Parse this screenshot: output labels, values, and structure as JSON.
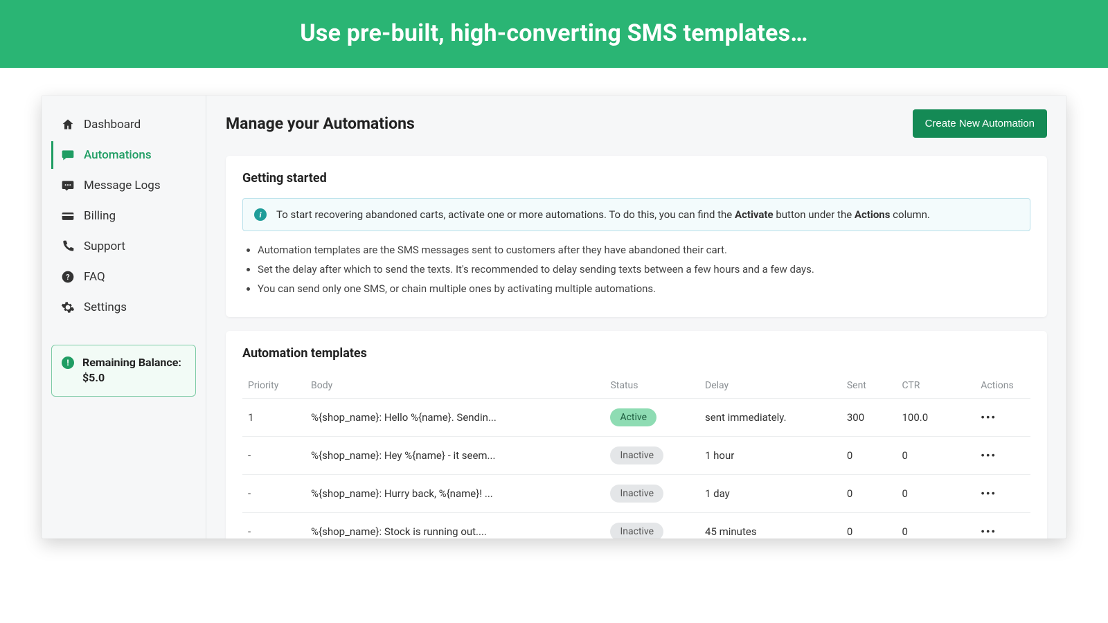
{
  "banner": {
    "headline": "Use pre-built, high-converting SMS templates…"
  },
  "sidebar": {
    "items": [
      {
        "label": "Dashboard",
        "icon": "home-icon"
      },
      {
        "label": "Automations",
        "icon": "chat-icon",
        "active": true
      },
      {
        "label": "Message Logs",
        "icon": "sms-icon"
      },
      {
        "label": "Billing",
        "icon": "card-icon"
      },
      {
        "label": "Support",
        "icon": "phone-icon"
      },
      {
        "label": "FAQ",
        "icon": "question-icon"
      },
      {
        "label": "Settings",
        "icon": "gear-icon"
      }
    ],
    "balance": {
      "label": "Remaining Balance: $5.0"
    }
  },
  "main": {
    "title": "Manage your Automations",
    "create_btn": "Create New Automation",
    "getting_started": {
      "title": "Getting started",
      "callout_pre": "To start recovering abandoned carts, activate one or more automations. To do this, you can find the ",
      "callout_b1": "Activate",
      "callout_mid": " button under the ",
      "callout_b2": "Actions",
      "callout_post": " column.",
      "bullets": [
        "Automation templates are the SMS messages sent to customers after they have abandoned their cart.",
        "Set the delay after which to send the texts. It's recommended to delay sending texts between a few hours and a few days.",
        "You can send only one SMS, or chain multiple ones by activating multiple automations."
      ]
    },
    "templates": {
      "title": "Automation templates",
      "headers": {
        "priority": "Priority",
        "body": "Body",
        "status": "Status",
        "delay": "Delay",
        "sent": "Sent",
        "ctr": "CTR",
        "actions": "Actions"
      },
      "rows": [
        {
          "priority": "1",
          "body": "%{shop_name}: Hello %{name}. Sendin...",
          "status": "Active",
          "delay": "sent immediately.",
          "sent": "300",
          "ctr": "100.0"
        },
        {
          "priority": "-",
          "body": "%{shop_name}: Hey %{name} - it seem...",
          "status": "Inactive",
          "delay": "1 hour",
          "sent": "0",
          "ctr": "0"
        },
        {
          "priority": "-",
          "body": "%{shop_name}: Hurry back, %{name}! ...",
          "status": "Inactive",
          "delay": "1 day",
          "sent": "0",
          "ctr": "0"
        },
        {
          "priority": "-",
          "body": "%{shop_name}: Stock is running out....",
          "status": "Inactive",
          "delay": "45 minutes",
          "sent": "0",
          "ctr": "0"
        }
      ]
    }
  }
}
